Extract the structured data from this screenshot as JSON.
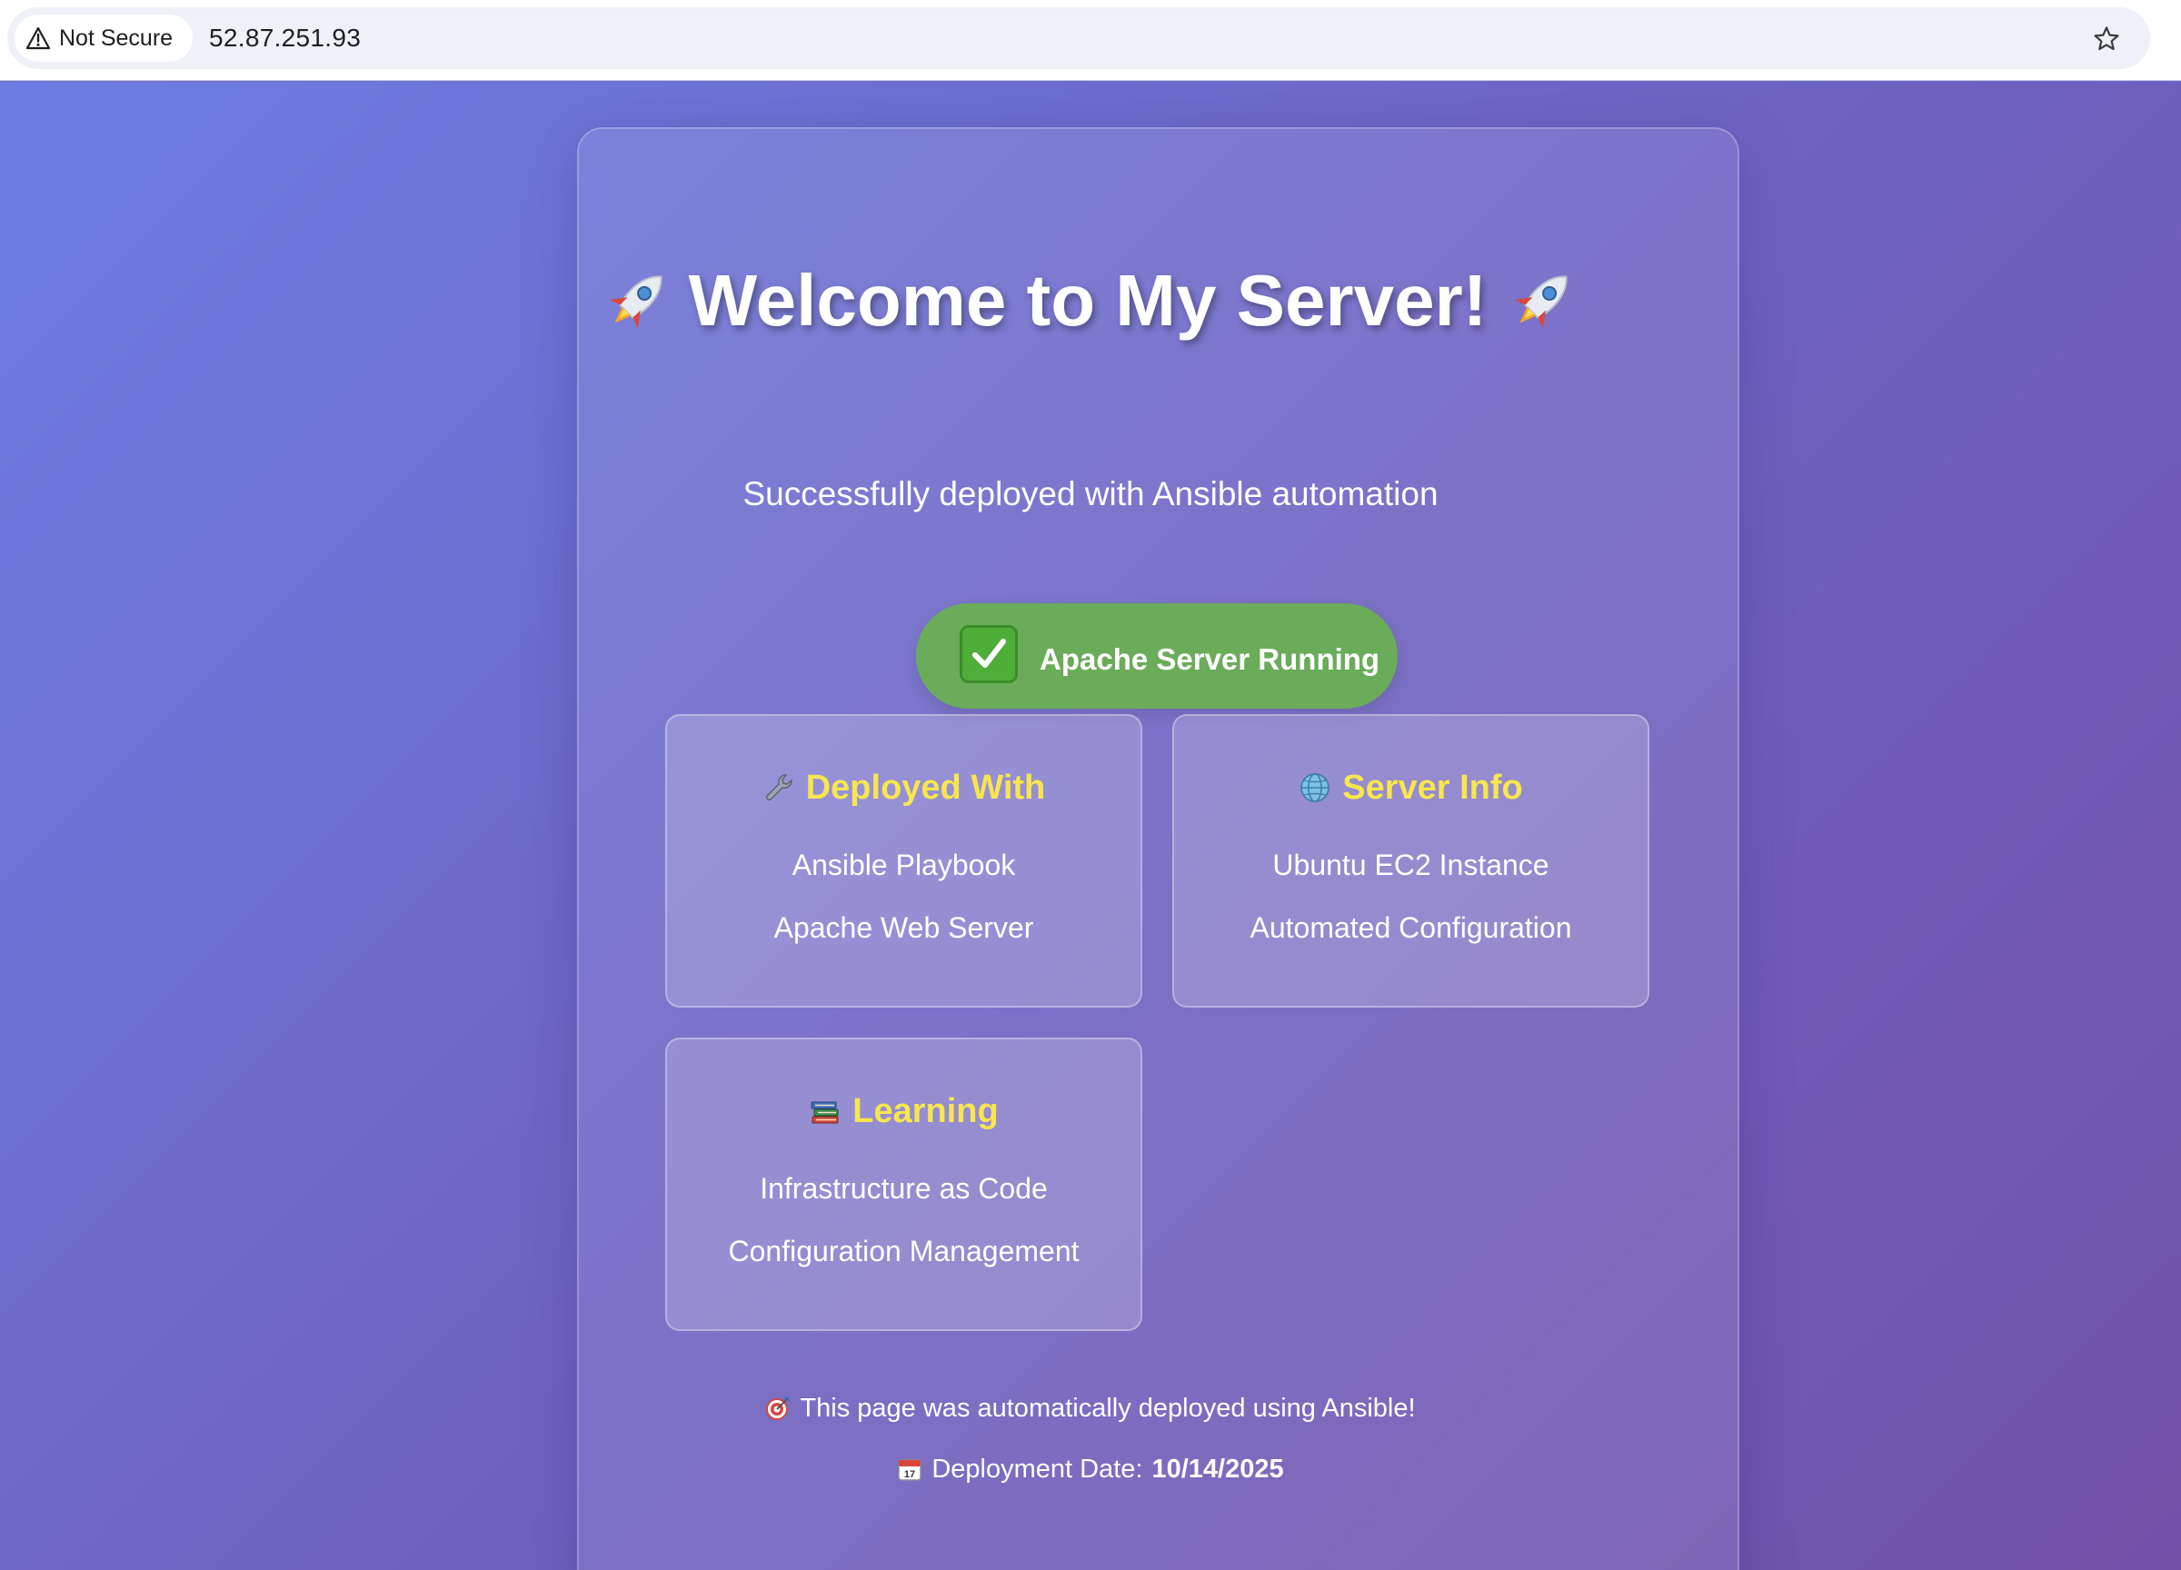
{
  "browser": {
    "security_label": "Not Secure",
    "url": "52.87.251.93",
    "security_icon": "warning-triangle-icon",
    "bookmark_icon": "star-icon"
  },
  "page": {
    "title": "Welcome to My Server!",
    "title_icon": "rocket-icon",
    "subtitle": "Successfully deployed with Ansible automation",
    "status": {
      "icon": "checkmark-icon",
      "label": "Apache Server Running",
      "color": "#6aac5a"
    },
    "info_boxes": [
      {
        "icon": "wrench-icon",
        "heading": "Deployed With",
        "lines": [
          "Ansible Playbook",
          "Apache Web Server"
        ]
      },
      {
        "icon": "globe-icon",
        "heading": "Server Info",
        "lines": [
          "Ubuntu EC2 Instance",
          "Automated Configuration"
        ]
      },
      {
        "icon": "books-icon",
        "heading": "Learning",
        "lines": [
          "Infrastructure as Code",
          "Configuration Management"
        ]
      }
    ],
    "footer": {
      "deploy_note_icon": "target-icon",
      "deploy_note": "This page was automatically deployed using Ansible!",
      "date_icon": "calendar-icon",
      "date_label": "Deployment Date:",
      "date_value": "10/14/2025"
    },
    "colors": {
      "heading_accent": "#f7e64e",
      "background_start": "#6d7de2",
      "background_end": "#7152a7"
    }
  }
}
